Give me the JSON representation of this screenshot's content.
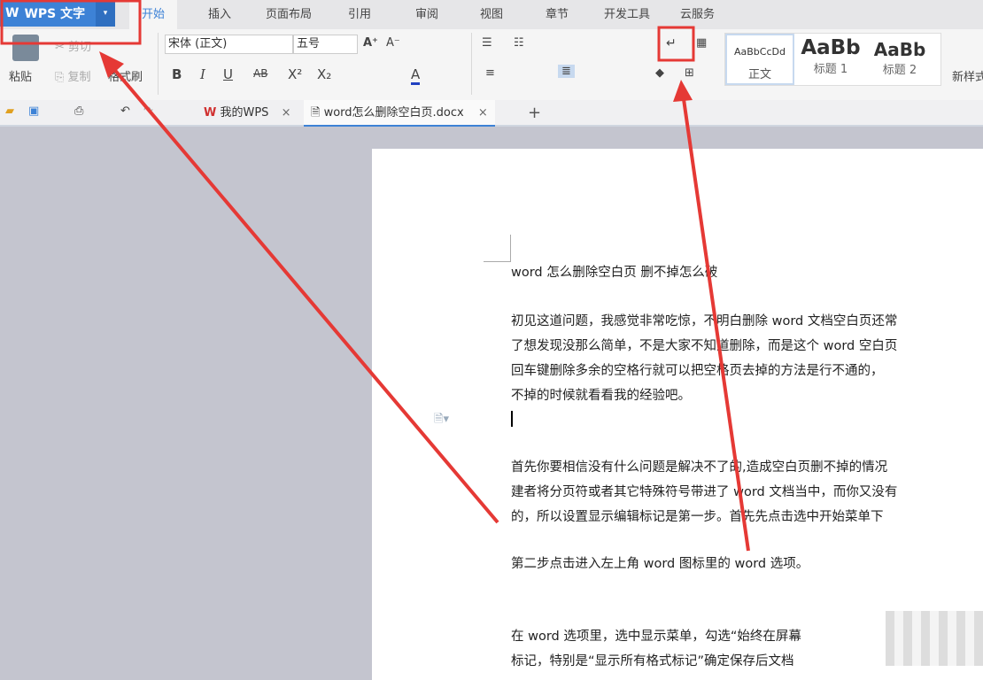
{
  "app": {
    "button_label": "WPS 文字",
    "dropdown": "▾"
  },
  "menu_tabs": [
    "开始",
    "插入",
    "页面布局",
    "引用",
    "审阅",
    "视图",
    "章节",
    "开发工具",
    "云服务"
  ],
  "clipboard": {
    "paste": "粘贴",
    "cut": "剪切",
    "copy": "复制",
    "format_painter": "格式刷"
  },
  "font": {
    "family": "宋体 (正文)",
    "size": "五号",
    "grow": "A⁺",
    "shrink": "A⁻",
    "bold": "B",
    "italic": "I",
    "underline": "U",
    "strike": "AB",
    "superscript": "X²",
    "subscript": "X₂",
    "color": "A"
  },
  "paragraph": {
    "show_marks": "↵"
  },
  "styles": [
    {
      "preview": "AaBbCcDd",
      "label": "正文"
    },
    {
      "preview": "AaBb",
      "label": "标题 1"
    },
    {
      "preview": "AaBb",
      "label": "标题 2"
    }
  ],
  "new_style": "新样式",
  "doc_tabs": [
    {
      "label": "我的WPS",
      "close": "×"
    },
    {
      "label": "word怎么删除空白页.docx",
      "close": "×"
    }
  ],
  "new_tab": "+",
  "document": {
    "title": "word 怎么删除空白页  删不掉怎么破",
    "paragraphs": [
      [
        "初见这道问题，我感觉非常吃惊，不明白删除 word 文档空白页还常",
        "了想发现没那么简单，不是大家不知道删除，而是这个 word 空白页",
        "回车键删除多余的空格行就可以把空格页去掉的方法是行不通的，",
        "不掉的时候就看看我的经验吧。"
      ],
      [
        "首先你要相信没有什么问题是解决不了的,造成空白页删不掉的情况",
        "建者将分页符或者其它特殊符号带进了 word 文档当中，而你又没有",
        "的，所以设置显示编辑标记是第一步。首先先点击选中开始菜单下"
      ],
      [
        "第二步点击进入左上角 word 图标里的 word 选项。"
      ],
      [
        "在 word 选项里，选中显示菜单，勾选“始终在屏幕",
        "标记，特别是“显示所有格式标记”确定保存后文档"
      ]
    ]
  },
  "colors": {
    "accent": "#3d82d6",
    "annotation": "#e53935"
  }
}
